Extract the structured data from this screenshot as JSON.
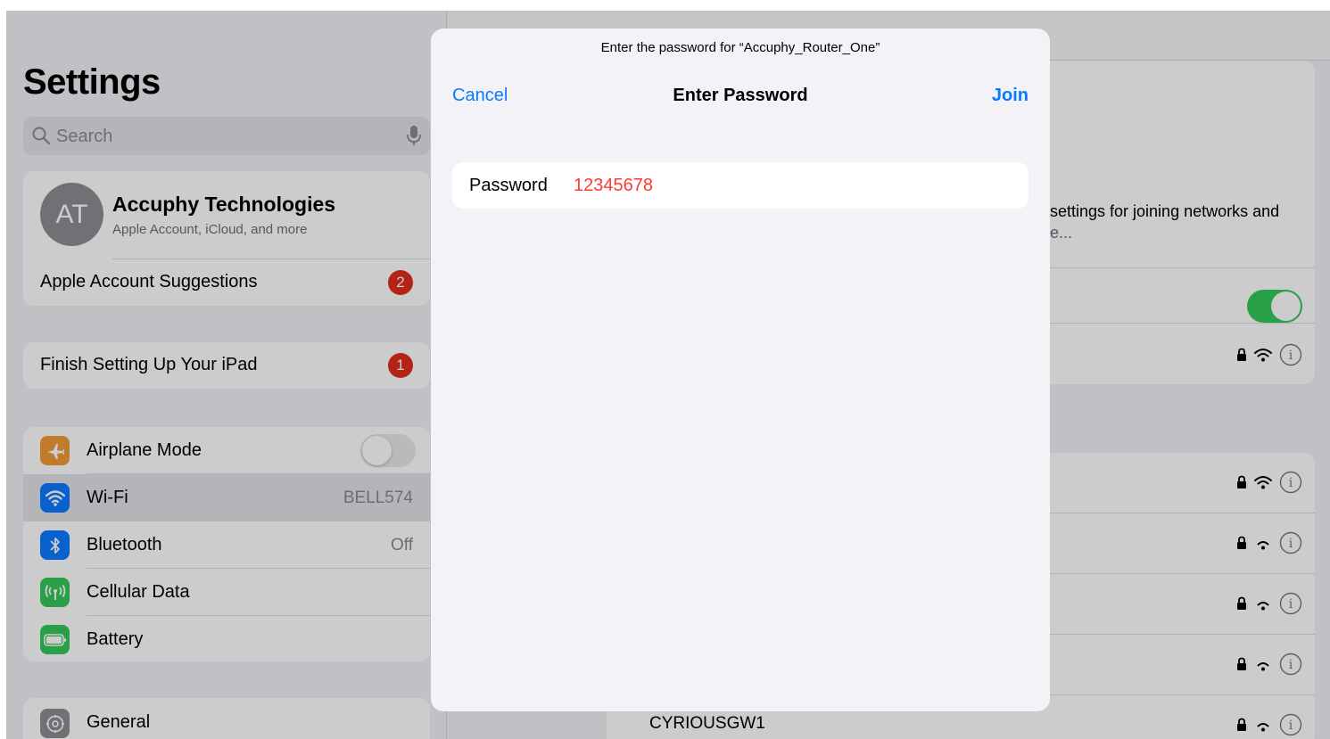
{
  "sidebar": {
    "title": "Settings",
    "search_placeholder": "Search",
    "account": {
      "initials": "AT",
      "name": "Accuphy Technologies",
      "subtitle": "Apple Account, iCloud, and more",
      "suggestions_label": "Apple Account Suggestions",
      "suggestions_badge": "2"
    },
    "finish_setup": {
      "label": "Finish Setting Up Your iPad",
      "badge": "1"
    },
    "items": [
      {
        "label": "Airplane Mode",
        "icon": "airplane-icon",
        "color": "#f19a37",
        "toggle": false
      },
      {
        "label": "Wi-Fi",
        "icon": "wifi-icon",
        "color": "#0a7aff",
        "value": "BELL574"
      },
      {
        "label": "Bluetooth",
        "icon": "bluetooth-icon",
        "color": "#0a7aff",
        "value": "Off"
      },
      {
        "label": "Cellular Data",
        "icon": "antenna-icon",
        "color": "#34c759"
      },
      {
        "label": "Battery",
        "icon": "battery-icon",
        "color": "#34c759"
      }
    ],
    "general": {
      "label": "General",
      "icon": "gear-icon"
    }
  },
  "detail": {
    "description_partial_line1": "settings for joining networks and",
    "description_partial_line2": "e...",
    "wifi_toggle_on": true,
    "network_visible_name": "CYRIOUSGW1"
  },
  "modal": {
    "prompt": "Enter the password for “Accuphy_Router_One”",
    "cancel": "Cancel",
    "title": "Enter Password",
    "join": "Join",
    "password_label": "Password",
    "password_value": "12345678"
  },
  "colors": {
    "accent": "#0a7aff",
    "badge": "#e02d1c",
    "password_text": "#ff3b30",
    "toggle_on": "#34c759"
  }
}
